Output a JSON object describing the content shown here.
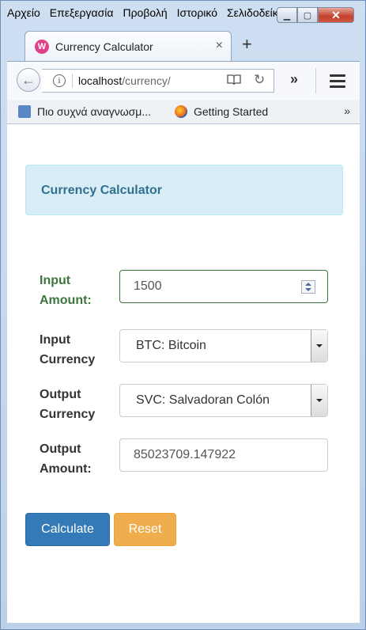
{
  "menu": {
    "items": [
      "Αρχείο",
      "Επεξεργασία",
      "Προβολή",
      "Ιστορικό",
      "Σελιδοδείκτες"
    ]
  },
  "window_controls": {
    "minimize": "▁",
    "maximize": "▢",
    "close": "✕"
  },
  "tab": {
    "title": "Currency Calculator",
    "favicon_letter": "W",
    "close": "×"
  },
  "new_tab": "+",
  "nav": {
    "back": "←",
    "url_host": "localhost",
    "url_path": "/currency/",
    "info": "i",
    "reader": "📖",
    "reload": "↻",
    "overflow": "»"
  },
  "bookmarks": {
    "items": [
      {
        "label": "Πιο συχνά αναγνωσμ...",
        "icon": "most-visited-icon"
      },
      {
        "label": "Getting Started",
        "icon": "firefox-icon"
      }
    ],
    "more": "»"
  },
  "panel": {
    "heading": "Currency Calculator"
  },
  "form": {
    "input_amount": {
      "label_line1": "Input",
      "label_line2": "Amount:",
      "value": "1500"
    },
    "input_currency": {
      "label_line1": "Input",
      "label_line2": "Currency",
      "selected": "BTC: Bitcoin"
    },
    "output_currency": {
      "label_line1": "Output",
      "label_line2": "Currency",
      "selected": "SVC: Salvadoran Colón"
    },
    "output_amount": {
      "label_line1": "Output",
      "label_line2": "Amount:",
      "value": "85023709.147922"
    }
  },
  "buttons": {
    "calculate": "Calculate",
    "reset": "Reset"
  },
  "colors": {
    "primary": "#337ab7",
    "warning": "#f0ad4e",
    "success": "#3c763d",
    "info_bg": "#d9edf7",
    "info_text": "#31708f"
  }
}
